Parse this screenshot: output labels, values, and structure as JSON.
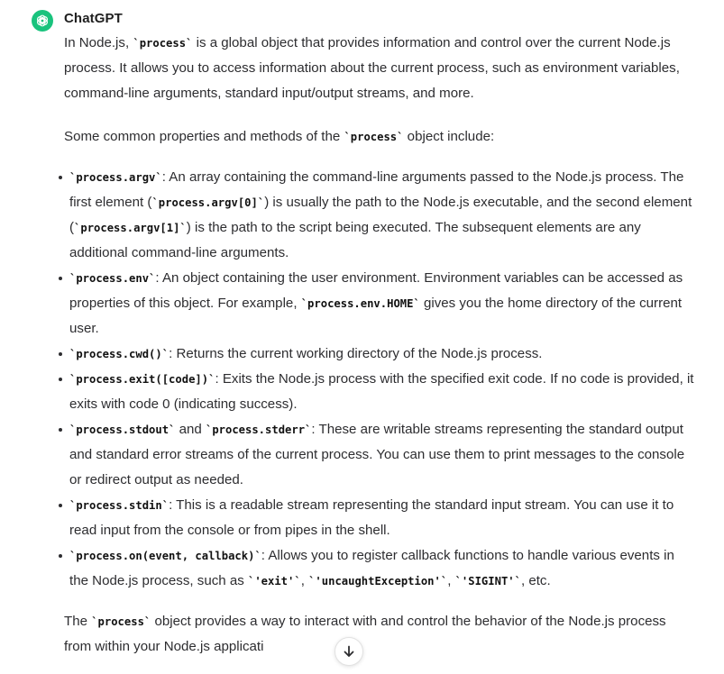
{
  "author": "ChatGPT",
  "intro": {
    "t1": "In Node.js, ",
    "c1": "`process`",
    "t2": " is a global object that provides information and control over the current Node.js process. It allows you to access information about the current process, such as environment variables, command-line arguments, standard input/output streams, and more."
  },
  "lead": {
    "t1": "Some common properties and methods of the ",
    "c1": "`process`",
    "t2": " object include:"
  },
  "items": [
    {
      "c1": "`process.argv`",
      "t1": ": An array containing the command-line arguments passed to the Node.js process. The first element (",
      "c2": "`process.argv[0]`",
      "t2": ") is usually the path to the Node.js executable, and the second element (",
      "c3": "`process.argv[1]`",
      "t3": ") is the path to the script being executed. The subsequent elements are any additional command-line arguments."
    },
    {
      "c1": "`process.env`",
      "t1": ": An object containing the user environment. Environment variables can be accessed as properties of this object. For example, ",
      "c2": "`process.env.HOME`",
      "t2": " gives you the home directory of the current user."
    },
    {
      "c1": "`process.cwd()`",
      "t1": ": Returns the current working directory of the Node.js process."
    },
    {
      "c1": "`process.exit([code])`",
      "t1": ": Exits the Node.js process with the specified exit code. If no code is provided, it exits with code 0 (indicating success)."
    },
    {
      "c1": "`process.stdout`",
      "t1": " and ",
      "c2": "`process.stderr`",
      "t2": ": These are writable streams representing the standard output and standard error streams of the current process. You can use them to print messages to the console or redirect output as needed."
    },
    {
      "c1": "`process.stdin`",
      "t1": ": This is a readable stream representing the standard input stream. You can use it to read input from the console or from pipes in the shell."
    },
    {
      "c1": "`process.on(event, callback)`",
      "t1": ": Allows you to register callback functions to handle various events in the Node.js process, such as ",
      "c2": "`'exit'`",
      "t2": ", ",
      "c3": "`'uncaughtException'`",
      "t3": ", ",
      "c4": "`'SIGINT'`",
      "t4": ", etc."
    }
  ],
  "outro": {
    "t1": "The ",
    "c1": "`process`",
    "t2": " object provides a way to interact with and control the behavior of the Node.js process from within your Node.js applicati"
  },
  "icons": {
    "avatar": "openai-logo-icon",
    "scroll": "arrow-down-icon"
  },
  "colors": {
    "avatar_bg": "#19c37d",
    "text": "#2d2d30"
  }
}
